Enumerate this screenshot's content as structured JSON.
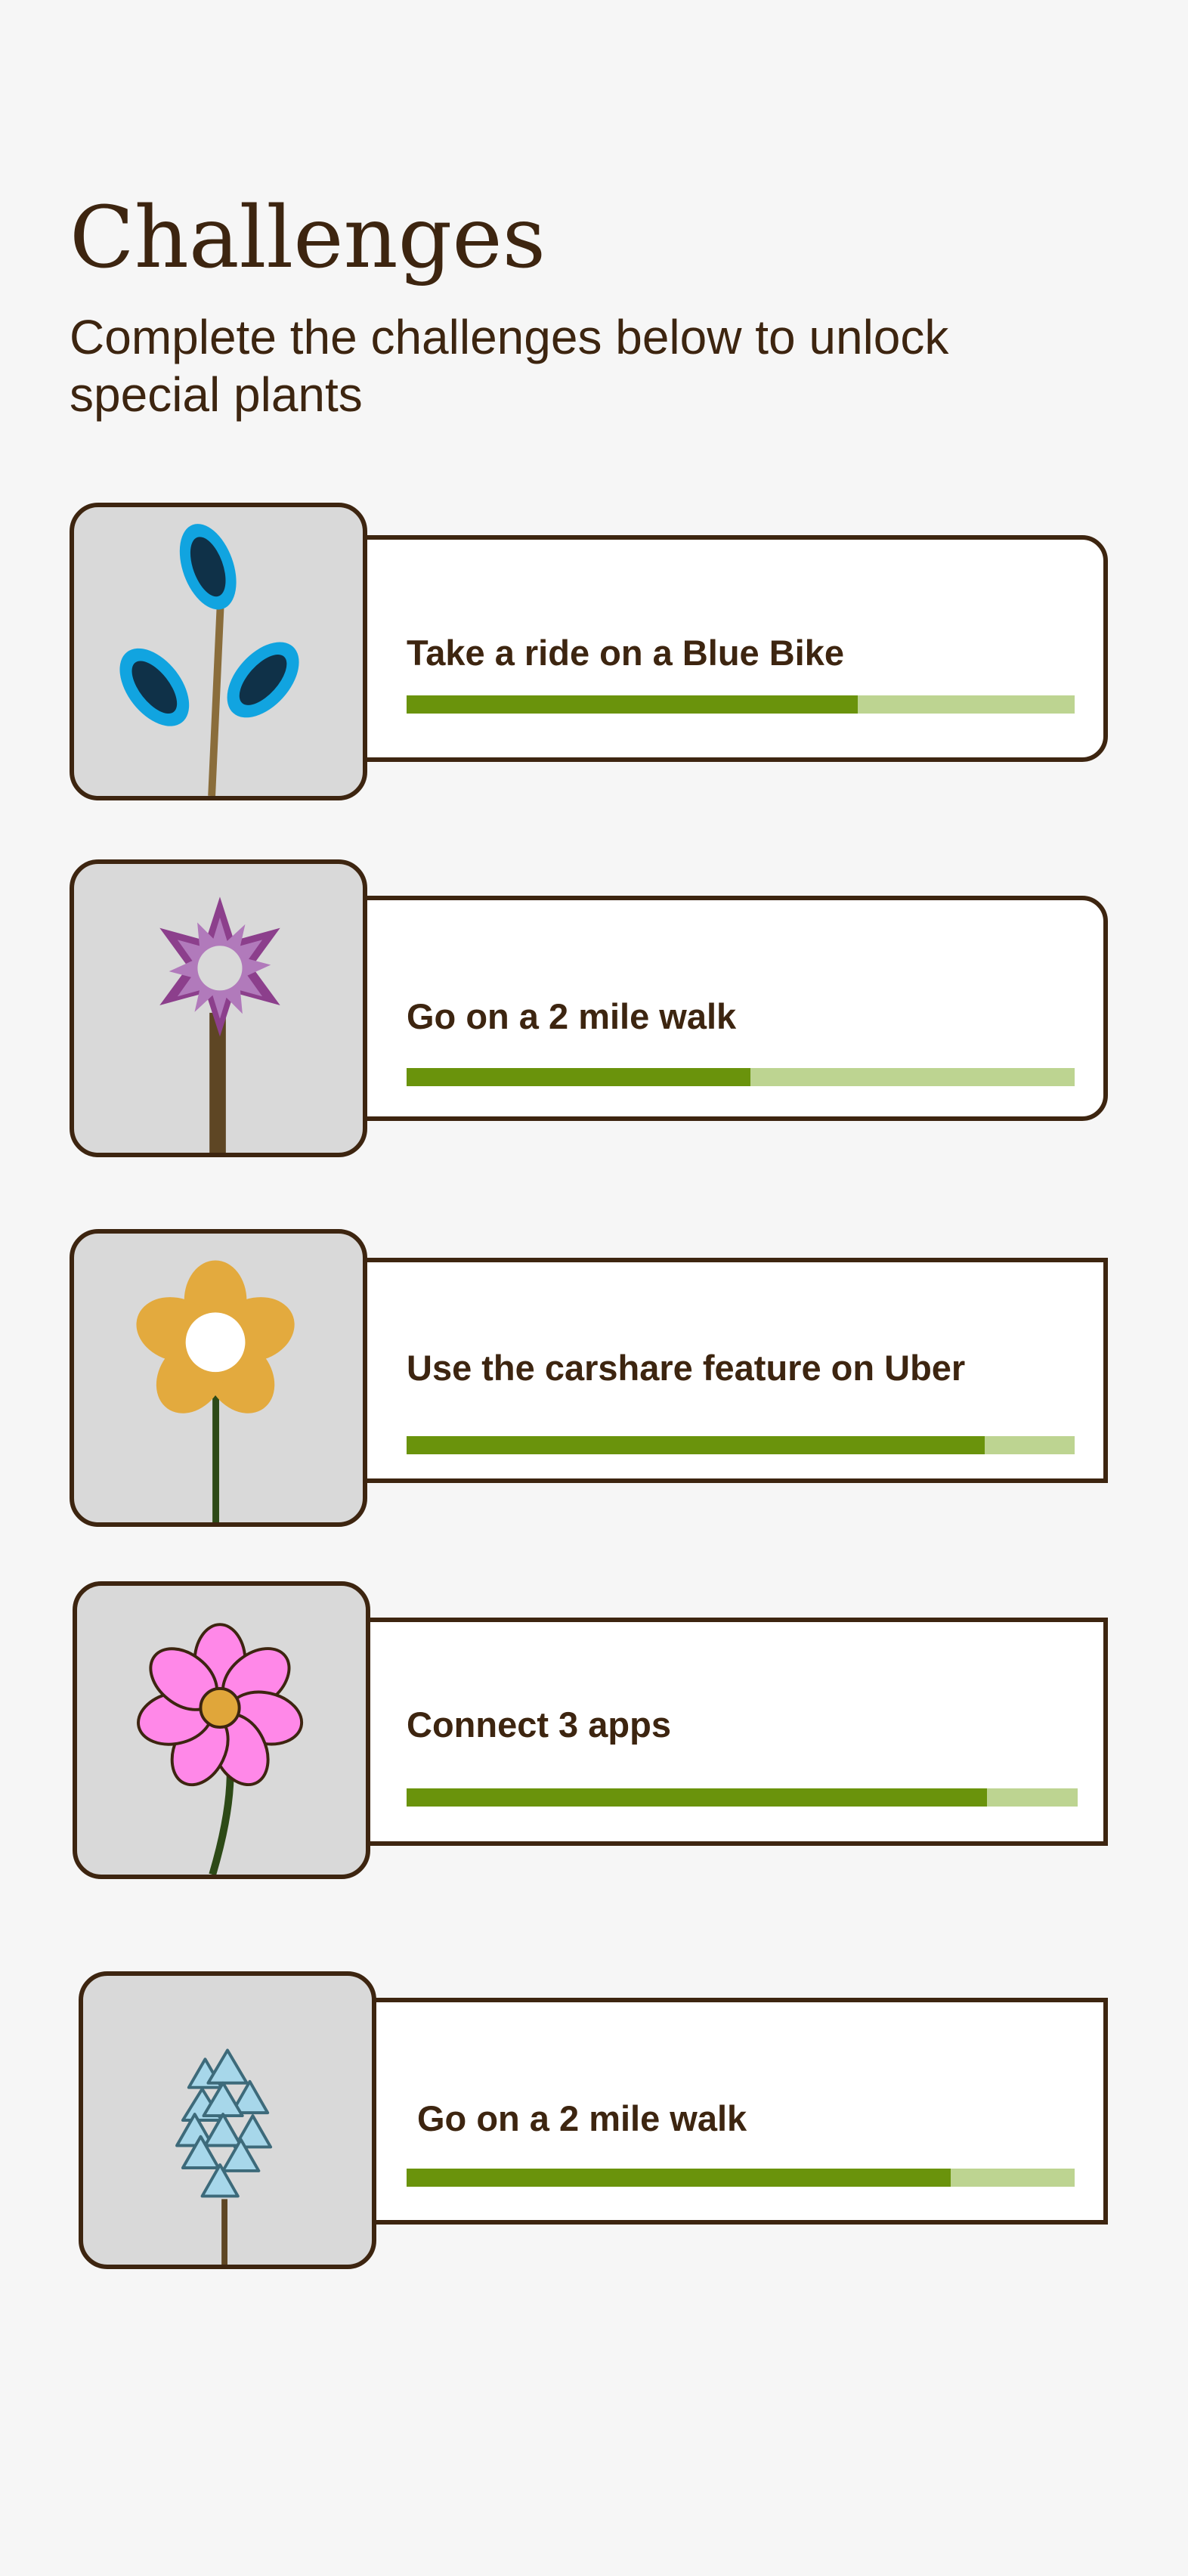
{
  "header": {
    "title": "Challenges",
    "subtitle": "Complete the challenges below to unlock special plants"
  },
  "challenges": [
    {
      "label": "Take a ride on a Blue Bike",
      "progress": 0.675,
      "plant_icon": "blue-leaf-sprout-icon"
    },
    {
      "label": "Go on a 2 mile walk",
      "progress": 0.515,
      "plant_icon": "purple-star-flower-icon"
    },
    {
      "label": "Use the carshare feature on Uber",
      "progress": 0.865,
      "plant_icon": "yellow-daisy-icon"
    },
    {
      "label": "Connect 3 apps",
      "progress": 0.865,
      "plant_icon": "pink-flower-icon"
    },
    {
      "label": "Go on a 2 mile walk",
      "progress": 0.815,
      "plant_icon": "blue-triangle-plant-icon"
    }
  ],
  "colors": {
    "background": "#f6f6f6",
    "text": "#3d2510",
    "progress_fill": "#6a930c",
    "progress_track": "#bdd491",
    "thumbnail_bg": "#d9d9d9"
  }
}
